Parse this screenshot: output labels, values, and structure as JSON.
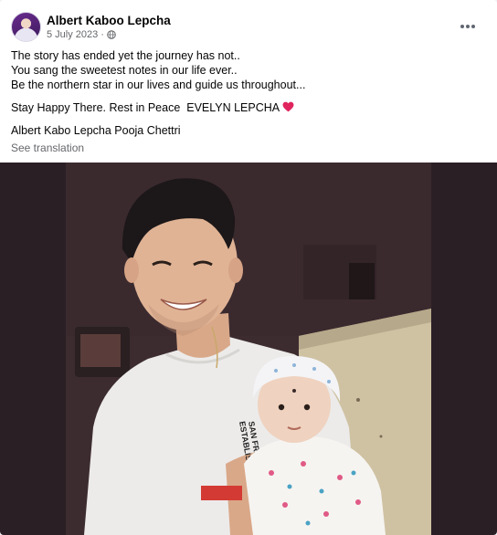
{
  "post": {
    "author": "Albert Kaboo Lepcha",
    "date": "5 July 2023",
    "separator": "·",
    "lines": [
      "The story has ended yet the journey has not..",
      "You sang the sweetest notes in our life ever..",
      "Be the northern star in our lives and guide us throughout..."
    ],
    "tribute": "Stay Happy There. Rest in Peace  EVELYN LEPCHA",
    "tags": "Albert Kabo Lepcha Pooja Chettri",
    "see_translation": "See translation",
    "shirt_print": [
      "SAN FRANC",
      "ESTABLISHE"
    ]
  },
  "icons": {
    "privacy": "globe-icon",
    "options": "more-options-icon",
    "emoji": "red-heart-icon"
  },
  "colors": {
    "secondary_text": "#65676b",
    "heart": "#e0245e"
  }
}
